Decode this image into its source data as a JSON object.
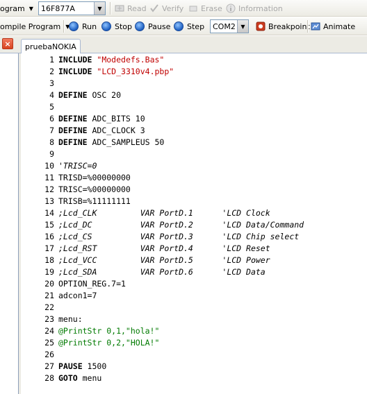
{
  "toolbar1": {
    "program_label": "ogram",
    "device_value": "16F877A",
    "read_label": "Read",
    "verify_label": "Verify",
    "erase_label": "Erase",
    "information_label": "Information"
  },
  "toolbar2": {
    "compile_label": "ompile Program",
    "run_label": "Run",
    "stop_label": "Stop",
    "pause_label": "Pause",
    "step_label": "Step",
    "port_value": "COM2",
    "breakpoint_label": "Breakpoint",
    "animate_label": "Animate"
  },
  "tabs": {
    "close_glyph": "×",
    "active_tab": "pruebaNOKIA"
  },
  "editor": {
    "lines": [
      {
        "n": "1",
        "segs": [
          {
            "t": "INCLUDE",
            "c": "kw"
          },
          {
            "t": " "
          },
          {
            "t": "\"Modedefs.Bas\"",
            "c": "str"
          }
        ]
      },
      {
        "n": "2",
        "segs": [
          {
            "t": "INCLUDE",
            "c": "kw"
          },
          {
            "t": " "
          },
          {
            "t": "\"LCD_3310v4.pbp\"",
            "c": "str"
          }
        ]
      },
      {
        "n": "3",
        "segs": []
      },
      {
        "n": "4",
        "segs": [
          {
            "t": "DEFINE",
            "c": "kw"
          },
          {
            "t": " OSC 20"
          }
        ]
      },
      {
        "n": "5",
        "segs": []
      },
      {
        "n": "6",
        "segs": [
          {
            "t": "DEFINE",
            "c": "kw"
          },
          {
            "t": " ADC_BITS 10"
          }
        ]
      },
      {
        "n": "7",
        "segs": [
          {
            "t": "DEFINE",
            "c": "kw"
          },
          {
            "t": " ADC_CLOCK 3"
          }
        ]
      },
      {
        "n": "8",
        "segs": [
          {
            "t": "DEFINE",
            "c": "kw"
          },
          {
            "t": " ADC_SAMPLEUS 50"
          }
        ]
      },
      {
        "n": "9",
        "segs": []
      },
      {
        "n": "10",
        "segs": [
          {
            "t": "'TRISC=0",
            "c": "cm"
          }
        ]
      },
      {
        "n": "11",
        "segs": [
          {
            "t": "TRISD=%00000000"
          }
        ]
      },
      {
        "n": "12",
        "segs": [
          {
            "t": "TRISC=%00000000"
          }
        ]
      },
      {
        "n": "13",
        "segs": [
          {
            "t": "TRISB=%11111111"
          }
        ]
      },
      {
        "n": "14",
        "segs": [
          {
            "t": ";Lcd_CLK         VAR PortD.1      'LCD Clock",
            "c": "cm"
          }
        ]
      },
      {
        "n": "15",
        "segs": [
          {
            "t": ";Lcd_DC          VAR PortD.2      'LCD Data/Command",
            "c": "cm"
          }
        ]
      },
      {
        "n": "16",
        "segs": [
          {
            "t": ";Lcd_CS          VAR PortD.3      'LCD Chip select",
            "c": "cm"
          }
        ]
      },
      {
        "n": "17",
        "segs": [
          {
            "t": ";Lcd_RST         VAR PortD.4      'LCD Reset",
            "c": "cm"
          }
        ]
      },
      {
        "n": "18",
        "segs": [
          {
            "t": ";Lcd_VCC         VAR PortD.5      'LCD Power",
            "c": "cm"
          }
        ]
      },
      {
        "n": "19",
        "segs": [
          {
            "t": ";Lcd_SDA         VAR PortD.6      'LCD Data",
            "c": "cm"
          }
        ]
      },
      {
        "n": "20",
        "segs": [
          {
            "t": "OPTION_REG.7=1"
          }
        ]
      },
      {
        "n": "21",
        "segs": [
          {
            "t": "adcon1=7"
          }
        ]
      },
      {
        "n": "22",
        "segs": []
      },
      {
        "n": "23",
        "segs": [
          {
            "t": "menu:"
          }
        ]
      },
      {
        "n": "24",
        "segs": [
          {
            "t": "@PrintStr 0,1,\"hola!\"",
            "c": "grn"
          }
        ]
      },
      {
        "n": "25",
        "segs": [
          {
            "t": "@PrintStr 0,2,\"HOLA!\"",
            "c": "grn"
          }
        ]
      },
      {
        "n": "26",
        "segs": []
      },
      {
        "n": "27",
        "segs": [
          {
            "t": "PAUSE",
            "c": "kw"
          },
          {
            "t": " 1500"
          }
        ]
      },
      {
        "n": "28",
        "segs": [
          {
            "t": "GOTO",
            "c": "kw"
          },
          {
            "t": " menu"
          }
        ]
      }
    ]
  }
}
